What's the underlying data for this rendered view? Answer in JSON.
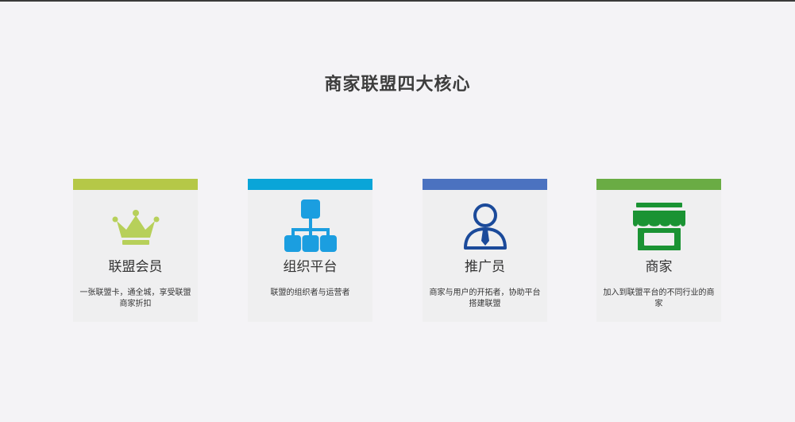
{
  "page": {
    "title": "商家联盟四大核心"
  },
  "colors": {
    "background": "#f4f3f6",
    "card_background": "#efeff0",
    "member_accent": "#b5c847",
    "platform_accent": "#0aa5d8",
    "promoter_accent": "#4b72c0",
    "merchant_accent": "#6aac44",
    "crown_icon": "#b7d05a",
    "org_icon": "#1b9ee0",
    "person_icon": "#1b4a9a",
    "store_icon": "#1a9333"
  },
  "cards": [
    {
      "icon": "crown-icon",
      "name": "联盟会员",
      "description": "一张联盟卡，通全城，享受联盟商家折扣"
    },
    {
      "icon": "org-chart-icon",
      "name": "组织平台",
      "description": "联盟的组织者与运营者"
    },
    {
      "icon": "person-tie-icon",
      "name": "推广员",
      "description": "商家与用户的开拓者，协助平台搭建联盟"
    },
    {
      "icon": "store-icon",
      "name": "商家",
      "description": "加入到联盟平台的不同行业的商家"
    }
  ]
}
